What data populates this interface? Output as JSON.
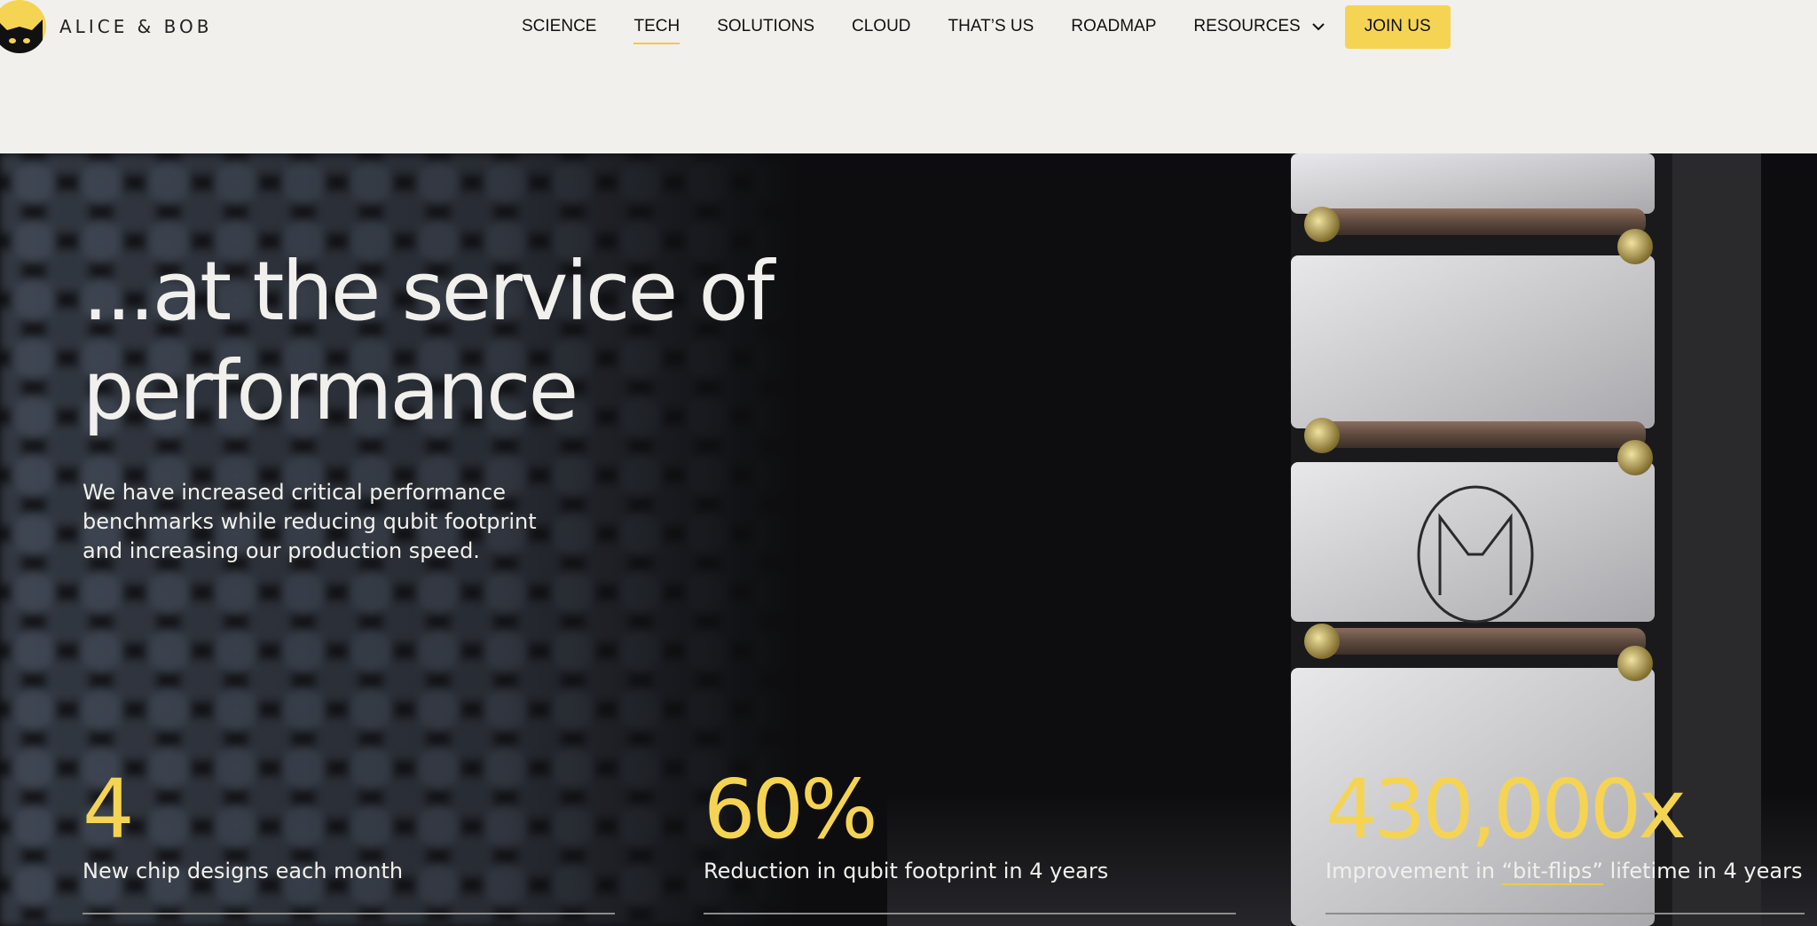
{
  "brand": {
    "name": "ALICE & BOB",
    "logo_icon": "cat-head-icon",
    "accent_color": "#f5d454"
  },
  "nav": {
    "items": [
      {
        "label": "SCIENCE",
        "active": false
      },
      {
        "label": "TECH",
        "active": true
      },
      {
        "label": "SOLUTIONS",
        "active": false
      },
      {
        "label": "CLOUD",
        "active": false
      },
      {
        "label": "THAT’S US",
        "active": false
      },
      {
        "label": "ROADMAP",
        "active": false
      }
    ],
    "resources_label": "RESOURCES",
    "resources_icon": "chevron-down-icon",
    "cta_label": "JOIN US"
  },
  "hero": {
    "title_line1": "...at the service of",
    "title_line2": "performance",
    "subtitle": "We have increased critical performance benchmarks while reducing qubit footprint and increasing our production speed.",
    "chip_logo_icon": "cat-outline-icon"
  },
  "stats": [
    {
      "value": "4",
      "label": "New chip designs each month"
    },
    {
      "value": "60%",
      "label": "Reduction in qubit footprint in 4 years"
    },
    {
      "value": "430,000x",
      "label_before": "Improvement in ",
      "label_underlined": "“bit-flips”",
      "label_after": " lifetime in 4 years"
    }
  ]
}
